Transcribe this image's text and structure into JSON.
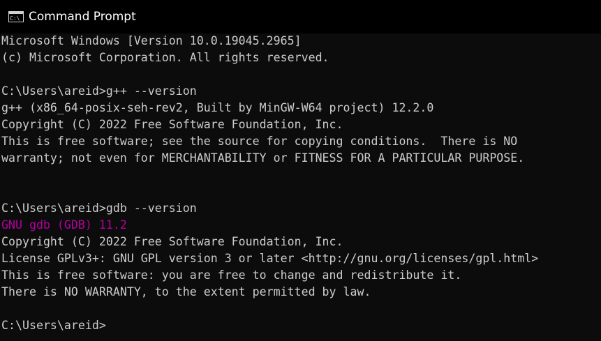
{
  "window": {
    "title": "Command Prompt",
    "icon": "cmd-icon"
  },
  "console": {
    "lines": [
      {
        "text": "Microsoft Windows [Version 10.0.19045.2965]",
        "color": "#cccccc"
      },
      {
        "text": "(c) Microsoft Corporation. All rights reserved.",
        "color": "#cccccc"
      },
      {
        "text": "",
        "color": "#cccccc"
      },
      {
        "text": "C:\\Users\\areid>g++ --version",
        "color": "#cccccc"
      },
      {
        "text": "g++ (x86_64-posix-seh-rev2, Built by MinGW-W64 project) 12.2.0",
        "color": "#cccccc"
      },
      {
        "text": "Copyright (C) 2022 Free Software Foundation, Inc.",
        "color": "#cccccc"
      },
      {
        "text": "This is free software; see the source for copying conditions.  There is NO",
        "color": "#cccccc"
      },
      {
        "text": "warranty; not even for MERCHANTABILITY or FITNESS FOR A PARTICULAR PURPOSE.",
        "color": "#cccccc"
      },
      {
        "text": "",
        "color": "#cccccc"
      },
      {
        "text": "",
        "color": "#cccccc"
      },
      {
        "text": "C:\\Users\\areid>gdb --version",
        "color": "#cccccc"
      },
      {
        "text": "GNU gdb (GDB) 11.2",
        "color": "#b4009e"
      },
      {
        "text": "Copyright (C) 2022 Free Software Foundation, Inc.",
        "color": "#cccccc"
      },
      {
        "text": "License GPLv3+: GNU GPL version 3 or later <http://gnu.org/licenses/gpl.html>",
        "color": "#cccccc"
      },
      {
        "text": "This is free software: you are free to change and redistribute it.",
        "color": "#cccccc"
      },
      {
        "text": "There is NO WARRANTY, to the extent permitted by law.",
        "color": "#cccccc"
      },
      {
        "text": "",
        "color": "#cccccc"
      },
      {
        "text": "C:\\Users\\areid>",
        "color": "#cccccc"
      }
    ]
  }
}
